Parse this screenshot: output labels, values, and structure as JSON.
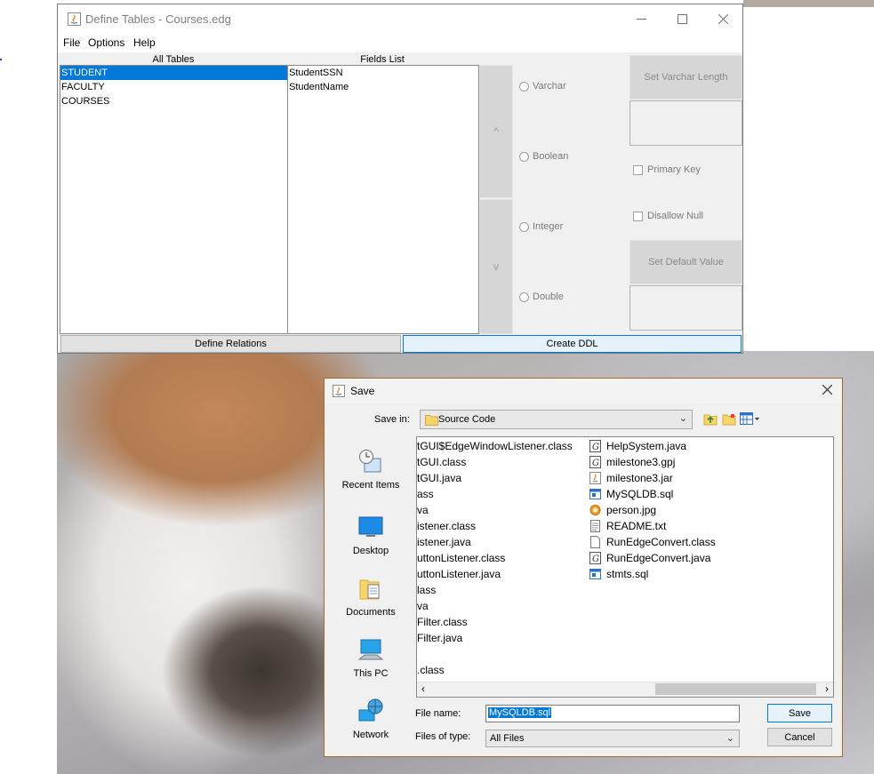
{
  "colors": {
    "accent": "#0078d7",
    "selection": "#0078d7",
    "dialog_border": "#a66a2c"
  },
  "define_tables": {
    "title": "Define Tables - Courses.edg",
    "menu": [
      "File",
      "Options",
      "Help"
    ],
    "all_tables_header": "All Tables",
    "fields_list_header": "Fields List",
    "tables": [
      "STUDENT",
      "FACULTY",
      "COURSES"
    ],
    "selected_table": "STUDENT",
    "fields": [
      "StudentSSN",
      "StudentName"
    ],
    "move_up_label": "^",
    "move_down_label": "v",
    "types": [
      "Varchar",
      "Boolean",
      "Integer",
      "Double"
    ],
    "set_varchar_length": "Set Varchar Length",
    "primary_key": "Primary Key",
    "disallow_null": "Disallow Null",
    "set_default_value": "Set Default Value",
    "define_relations": "Define Relations",
    "create_ddl": "Create DDL"
  },
  "save_dialog": {
    "title": "Save",
    "save_in_label": "Save in:",
    "save_in_value": "Source Code",
    "places": [
      "Recent Items",
      "Desktop",
      "Documents",
      "This PC",
      "Network"
    ],
    "files_left": [
      "tGUI$EdgeWindowListener.class",
      "tGUI.class",
      "tGUI.java",
      "ass",
      "va",
      "istener.class",
      "istener.java",
      "uttonListener.class",
      "uttonListener.java",
      "lass",
      "va",
      "Filter.class",
      "Filter.java",
      "",
      ".class"
    ],
    "files_right": [
      {
        "name": "HelpSystem.java",
        "icon": "java-file-icon"
      },
      {
        "name": "milestone3.gpj",
        "icon": "java-file-icon"
      },
      {
        "name": "milestone3.jar",
        "icon": "jar-file-icon"
      },
      {
        "name": "MySQLDB.sql",
        "icon": "sql-file-icon"
      },
      {
        "name": "person.jpg",
        "icon": "image-file-icon"
      },
      {
        "name": "README.txt",
        "icon": "text-file-icon"
      },
      {
        "name": "RunEdgeConvert.class",
        "icon": "blank-file-icon"
      },
      {
        "name": "RunEdgeConvert.java",
        "icon": "java-file-icon"
      },
      {
        "name": "stmts.sql",
        "icon": "sql-file-icon"
      }
    ],
    "file_name_label": "File name:",
    "file_name_value": "MySQLDB.sql",
    "files_of_type_label": "Files of type:",
    "files_of_type_value": "All Files",
    "save_button": "Save",
    "cancel_button": "Cancel"
  }
}
